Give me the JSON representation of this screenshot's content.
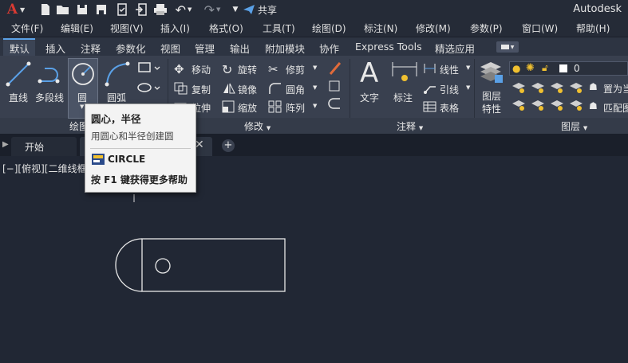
{
  "app": {
    "brand": "Autodesk",
    "share_label": "共享",
    "logo_letter": "A"
  },
  "menus": [
    "文件(F)",
    "编辑(E)",
    "视图(V)",
    "插入(I)",
    "格式(O)",
    "工具(T)",
    "绘图(D)",
    "标注(N)",
    "修改(M)",
    "参数(P)",
    "窗口(W)",
    "帮助(H)"
  ],
  "ribbon_tabs": [
    "默认",
    "插入",
    "注释",
    "参数化",
    "视图",
    "管理",
    "输出",
    "附加模块",
    "协作",
    "Express Tools",
    "精选应用"
  ],
  "draw_panel": {
    "title": "绘图",
    "line": "直线",
    "polyline": "多段线",
    "circle": "圆",
    "arc": "圆弧"
  },
  "modify_panel": {
    "title": "修改",
    "move": "移动",
    "rotate": "旋转",
    "trim": "修剪",
    "copy": "复制",
    "mirror": "镜像",
    "fillet": "圆角",
    "stretch": "拉伸",
    "scale": "缩放",
    "array": "阵列"
  },
  "annotation_panel": {
    "title": "注释",
    "text": "文字",
    "dimension": "标注",
    "linear": "线性",
    "leader": "引线",
    "table": "表格"
  },
  "layers_panel": {
    "title": "图层",
    "properties_line1": "图层",
    "properties_line2": "特性",
    "current_layer": "0",
    "set_current": "置为当",
    "match": "匹配图"
  },
  "doc_tabs": {
    "start": "开始"
  },
  "viewport_label": "[−][俯视][二维线框",
  "tooltip": {
    "title": "圆心，半径",
    "description": "用圆心和半径创建圆",
    "command": "CIRCLE",
    "help": "按 F1 键获得更多帮助"
  },
  "colors": {
    "accent": "#5aa0e6",
    "canvas": "#212734",
    "ribbon": "#39404f",
    "logo": "#d83a32"
  }
}
